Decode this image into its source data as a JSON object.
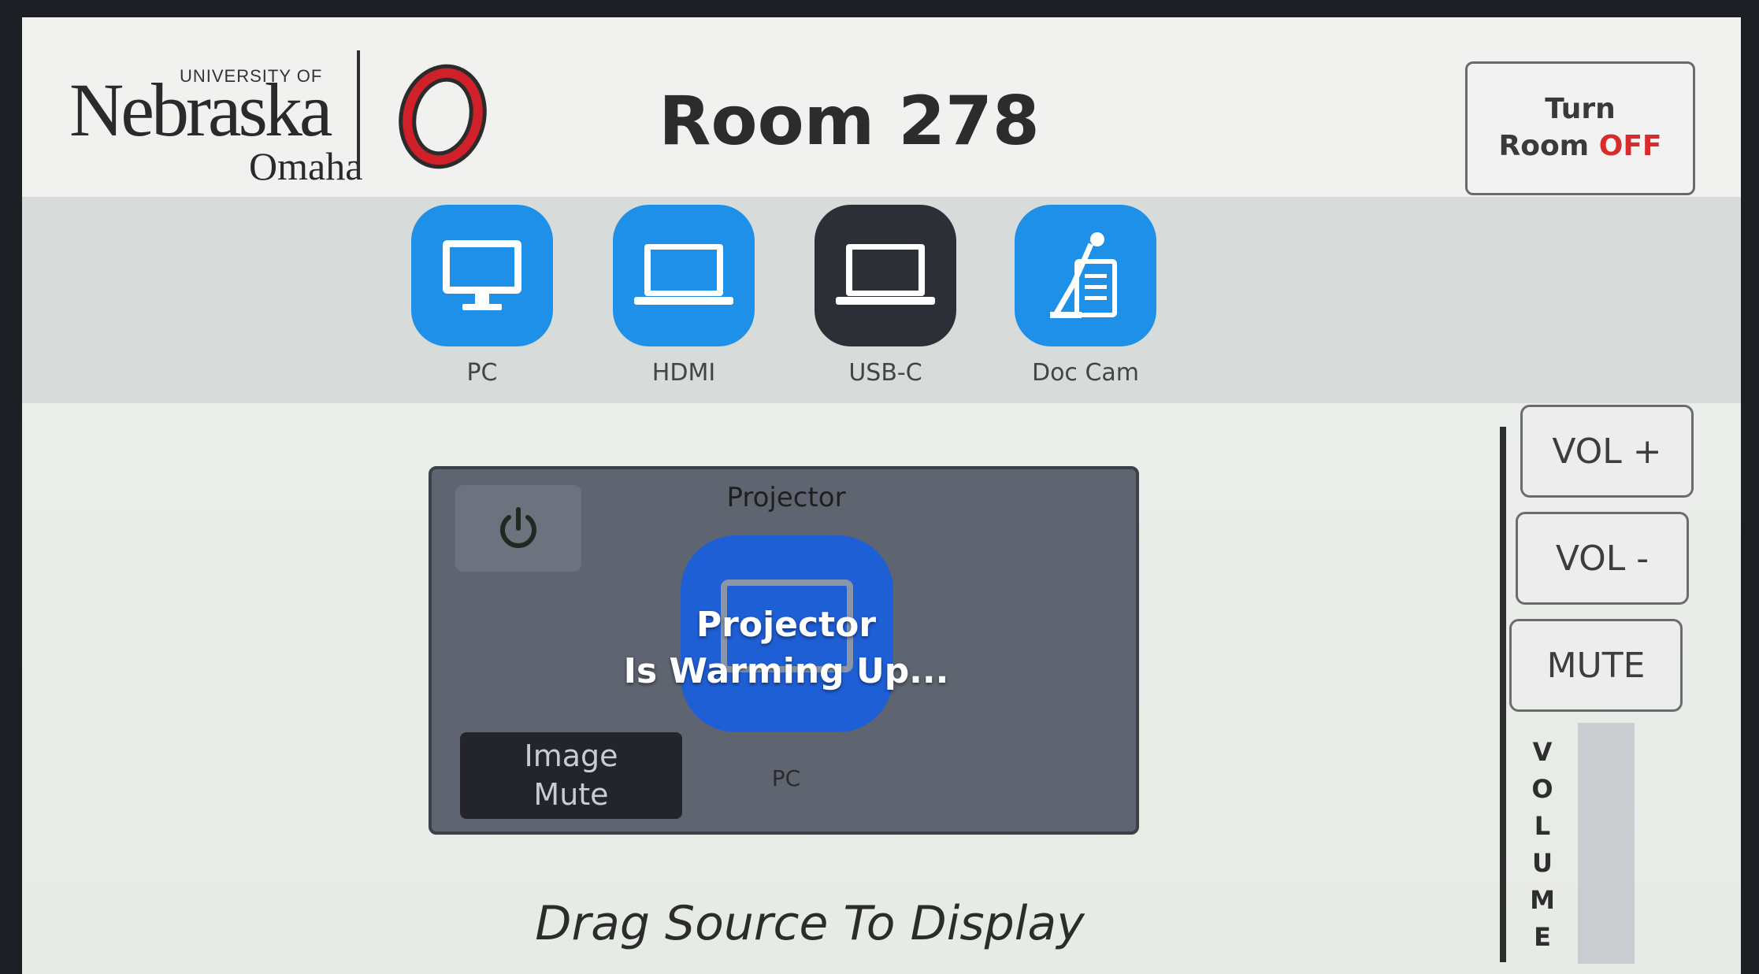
{
  "header": {
    "logo": {
      "university_of": "UNIVERSITY OF",
      "name": "Nebraska",
      "campus": "Omaha"
    },
    "room_title": "Room 278",
    "power_button": {
      "line1": "Turn",
      "line2_prefix": "Room ",
      "line2_suffix": "OFF",
      "accent_color": "#d92b2b"
    }
  },
  "sources": [
    {
      "label": "PC",
      "icon": "monitor-icon",
      "active": false
    },
    {
      "label": "HDMI",
      "icon": "laptop-icon",
      "active": false
    },
    {
      "label": "USB-C",
      "icon": "laptop-icon",
      "active": true
    },
    {
      "label": "Doc Cam",
      "icon": "document-camera-icon",
      "active": false
    }
  ],
  "projector": {
    "title": "Projector",
    "status_line1": "Projector",
    "status_line2": "Is Warming Up...",
    "image_mute_label": "Image\nMute",
    "current_source": "PC"
  },
  "instructions": "Drag Source To Display",
  "volume": {
    "up_label": "VOL +",
    "down_label": "VOL -",
    "mute_label": "MUTE",
    "label_letters": [
      "V",
      "O",
      "L",
      "U",
      "M",
      "E"
    ],
    "level": 0
  },
  "colors": {
    "source_blue": "#1e90e8",
    "source_active": "#2c2f36",
    "projector_blue": "#1f5fd6"
  }
}
